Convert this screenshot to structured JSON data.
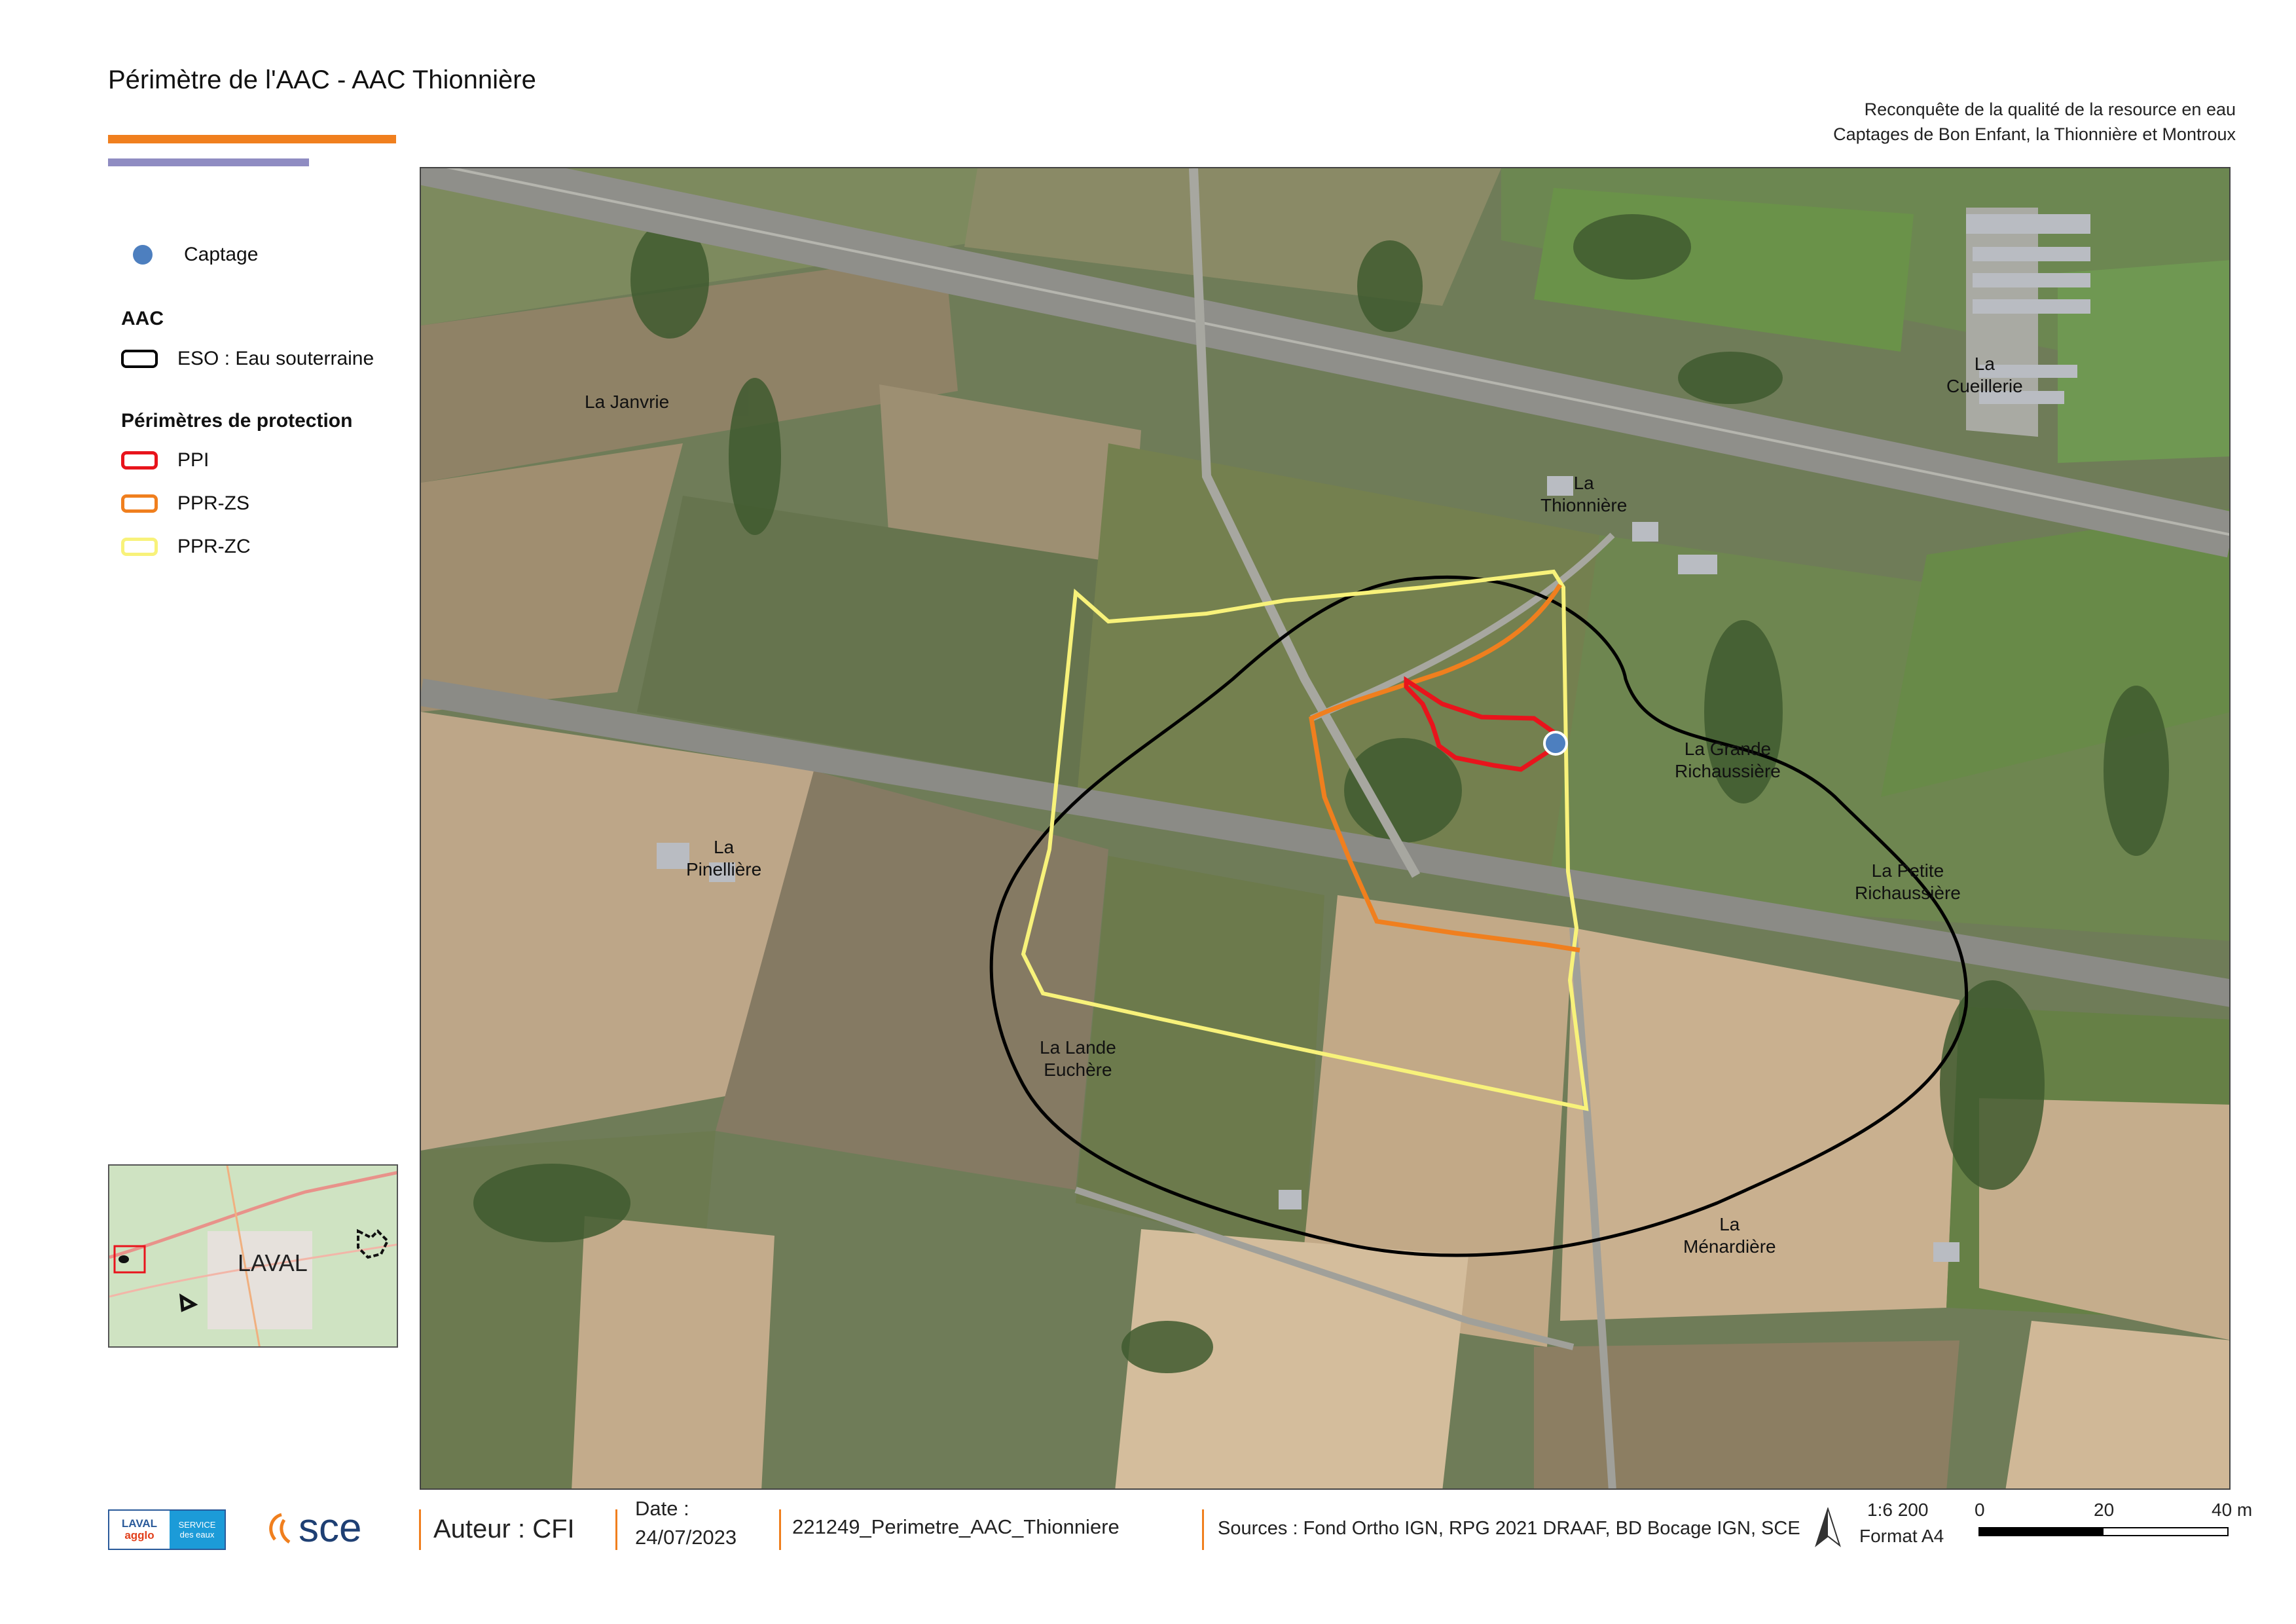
{
  "header": {
    "title": "Périmètre de l'AAC - AAC Thionnière",
    "subtitle_line1": "Reconquête de la qualité de la resource en eau",
    "subtitle_line2": "Captages de Bon Enfant, la Thionnière et Montroux"
  },
  "legend": {
    "captage": "Captage",
    "aac_heading": "AAC",
    "eso": "ESO : Eau souterraine",
    "protection_heading": "Périmètres de protection",
    "ppi": "PPI",
    "ppr_zs": "PPR-ZS",
    "ppr_zc": "PPR-ZC"
  },
  "colors": {
    "ppi": "#e8141c",
    "ppr_zs": "#f07f1e",
    "ppr_zc": "#f8f27a",
    "eso": "#000000",
    "captage": "#4d7fbf",
    "accent_bar": "#f07f1e",
    "accent_bar2": "#8f8cc2"
  },
  "places": {
    "janvrie": "La Janvrie",
    "cueillerie_1": "La",
    "cueillerie_2": "Cueillerie",
    "thionniere_1": "La",
    "thionniere_2": "Thionnière",
    "grande_1": "La Grande",
    "grande_2": "Richaussière",
    "pinelliere_1": "La",
    "pinelliere_2": "Pinellière",
    "petite_1": "La Petite",
    "petite_2": "Richaussière",
    "lande_1": "La Lande",
    "lande_2": "Euchère",
    "menardiere_1": "La",
    "menardiere_2": "Ménardière"
  },
  "inset": {
    "city": "LAVAL"
  },
  "footer": {
    "logo_laval_1": "LAVAL",
    "logo_laval_2": "agglo",
    "logo_service_1": "SERVICE",
    "logo_service_2": "des eaux",
    "logo_sce": "sce",
    "author": "Auteur : CFI",
    "date_label": "Date :",
    "date_value": "24/07/2023",
    "reference": "221249_Perimetre_AAC_Thionniere",
    "sources": "Sources : Fond Ortho IGN, RPG 2021 DRAAF, BD Bocage IGN, SCE",
    "scale": "1:6 200",
    "format": "Format A4",
    "scale_0": "0",
    "scale_20": "20",
    "scale_40": "40 m"
  }
}
